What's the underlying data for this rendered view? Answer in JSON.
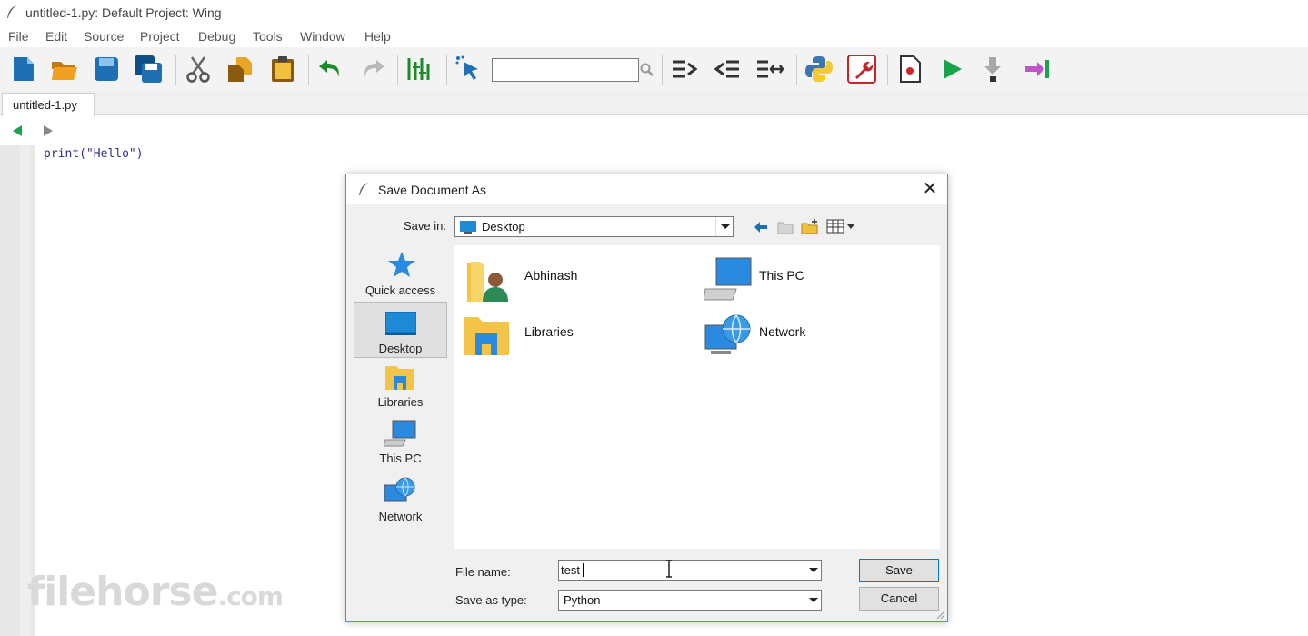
{
  "window": {
    "title": "untitled-1.py: Default Project: Wing"
  },
  "menu": [
    "File",
    "Edit",
    "Source",
    "Project",
    "Debug",
    "Tools",
    "Window",
    "Help"
  ],
  "toolbar": {
    "search_value": "",
    "icons": [
      "new-file-icon",
      "open-folder-icon",
      "save-icon",
      "save-all-icon",
      "cut-icon",
      "copy-icon",
      "paste-icon",
      "undo-icon",
      "redo-icon",
      "indent-guides-icon",
      "pointer-select-icon",
      "search-icon",
      "indent-right-icon",
      "indent-left-icon",
      "indent-toggle-icon",
      "python-icon",
      "wrench-icon",
      "breakpoint-doc-icon",
      "run-icon",
      "step-into-icon",
      "step-out-icon"
    ]
  },
  "editor": {
    "tab_label": "untitled-1.py",
    "code_line": "print(\"Hello\")"
  },
  "dialog": {
    "title": "Save Document As",
    "save_in_label": "Save in:",
    "save_in_value": "Desktop",
    "places": [
      {
        "label": "Quick access",
        "icon": "star-icon"
      },
      {
        "label": "Desktop",
        "icon": "desktop-icon",
        "selected": true
      },
      {
        "label": "Libraries",
        "icon": "libraries-icon"
      },
      {
        "label": "This PC",
        "icon": "computer-icon"
      },
      {
        "label": "Network",
        "icon": "network-icon"
      }
    ],
    "items": [
      {
        "name": "Abhinash",
        "icon": "user-folder-icon"
      },
      {
        "name": "This PC",
        "icon": "computer-icon"
      },
      {
        "name": "Libraries",
        "icon": "libraries-icon"
      },
      {
        "name": "Network",
        "icon": "network-icon"
      }
    ],
    "file_name_label": "File name:",
    "file_name_value": "test",
    "save_type_label": "Save as type:",
    "save_type_value": "Python",
    "save_button": "Save",
    "cancel_button": "Cancel",
    "close_glyph": "✕"
  },
  "watermark": {
    "main": "filehorse",
    "suffix": ".com"
  },
  "colors": {
    "accent": "#0078d7",
    "run_green": "#1aa34a",
    "toolbar_blue": "#1e6fb3"
  }
}
